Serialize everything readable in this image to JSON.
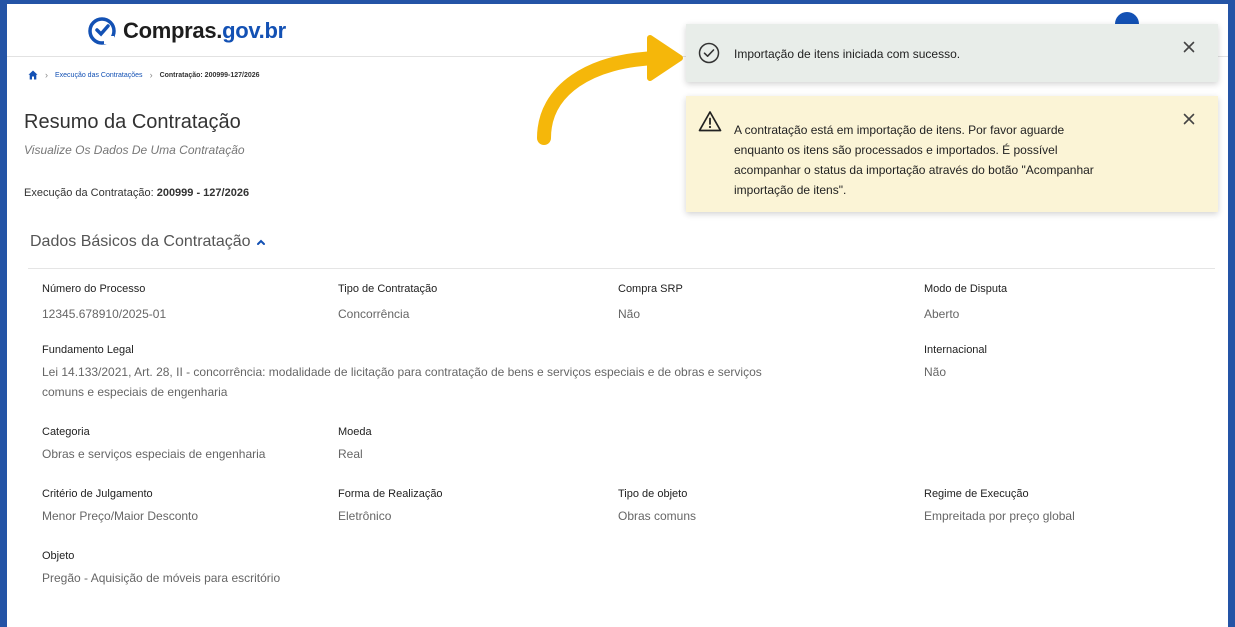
{
  "header": {
    "logo_text": "Compras.",
    "logo_tld": "gov.br"
  },
  "breadcrumb": {
    "items": [
      "Execução das Contratações",
      "Contratação: 200999-127/2026"
    ]
  },
  "page": {
    "title": "Resumo da Contratação",
    "subtitle": "Visualize Os Dados De Uma Contratação",
    "exec_label": "Execução da Contratação:",
    "exec_value": "200999 - 127/2026"
  },
  "section": {
    "title": "Dados Básicos da Contratação"
  },
  "fields": {
    "numero_processo": {
      "label": "Número do Processo",
      "value": "12345.678910/2025-01"
    },
    "tipo_contratacao": {
      "label": "Tipo de Contratação",
      "value": "Concorrência"
    },
    "compra_srp": {
      "label": "Compra SRP",
      "value": "Não"
    },
    "modo_disputa": {
      "label": "Modo de Disputa",
      "value": "Aberto"
    },
    "fundamento_legal": {
      "label": "Fundamento Legal",
      "value_line1": "Lei 14.133/2021, Art. 28, II - concorrência: modalidade de licitação para contratação de bens e serviços especiais e de obras e serviços",
      "value_line2": "comuns e especiais de engenharia"
    },
    "internacional": {
      "label": "Internacional",
      "value": "Não"
    },
    "categoria": {
      "label": "Categoria",
      "value": "Obras e serviços especiais de engenharia"
    },
    "moeda": {
      "label": "Moeda",
      "value": "Real"
    },
    "criterio_julgamento": {
      "label": "Critério de Julgamento",
      "value": "Menor Preço/Maior Desconto"
    },
    "forma_realizacao": {
      "label": "Forma de Realização",
      "value": "Eletrônico"
    },
    "tipo_objeto": {
      "label": "Tipo de objeto",
      "value": "Obras comuns"
    },
    "regime_execucao": {
      "label": "Regime de Execução",
      "value": "Empreitada por preço global"
    },
    "objeto": {
      "label": "Objeto",
      "value": "Pregão - Aquisição de móveis para escritório"
    }
  },
  "toasts": {
    "success": {
      "text": "Importação de itens iniciada com sucesso.",
      "icon": "check-circle-icon"
    },
    "warning": {
      "icon": "warning-triangle-icon",
      "line1": "A contratação está em importação de itens. Por favor aguarde",
      "line2": "enquanto os itens são processados e importados. É possível",
      "line3": "acompanhar o status da importação através do botão \"Acompanhar",
      "line4": "importação de itens\"."
    }
  },
  "colors": {
    "brand_blue": "#1351b4",
    "frame_blue": "#2454a6",
    "arrow_yellow": "#f5b70a",
    "success_bg": "#e8ede9",
    "warning_bg": "#fbf4d6"
  }
}
